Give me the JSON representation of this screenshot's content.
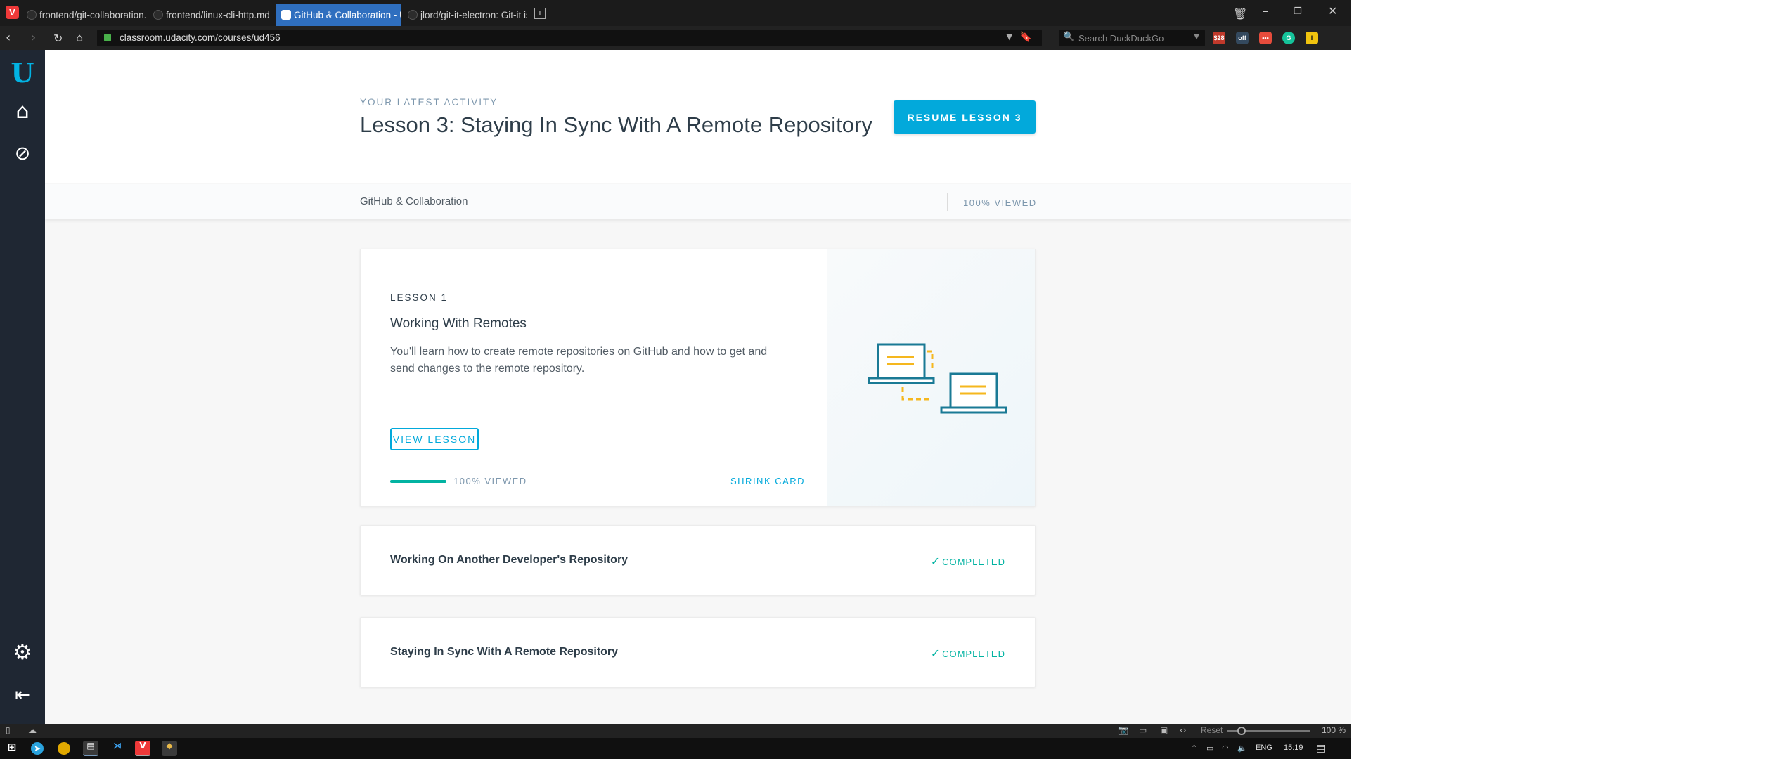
{
  "browser": {
    "tabs": [
      {
        "label": "frontend/git-collaboration.r"
      },
      {
        "label": "frontend/linux-cli-http.md ·"
      },
      {
        "label": "GitHub & Collaboration - U"
      },
      {
        "label": "jlord/git-it-electron: Git-it is"
      }
    ],
    "url": "classroom.udacity.com/courses/ud456",
    "search_placeholder": "Search DuckDuckGo",
    "extension_badge": "$28",
    "extension_badge2": "off"
  },
  "udacity": {
    "activity_label": "YOUR LATEST ACTIVITY",
    "activity_title": "Lesson 3: Staying In Sync With A Remote Repository",
    "resume_label": "RESUME LESSON 3",
    "course_name": "GitHub & Collaboration",
    "course_viewed": "100% VIEWED",
    "lesson_card": {
      "number": "LESSON 1",
      "title": "Working With Remotes",
      "description": "You'll learn how to create remote repositories on GitHub and how to get and send changes to the remote repository.",
      "view_label": "VIEW LESSON",
      "progress_fraction": 1.0,
      "progress_label": "100% VIEWED",
      "shrink_label": "SHRINK CARD"
    },
    "lessons": [
      {
        "title": "Working On Another Developer's Repository",
        "status": "COMPLETED"
      },
      {
        "title": "Staying In Sync With A Remote Repository",
        "status": "COMPLETED"
      }
    ],
    "colors": {
      "accent": "#02a9db",
      "success": "#02b3a2",
      "sidebar": "#1f2733"
    }
  },
  "statusbar": {
    "reset": "Reset",
    "zoom": "100 %"
  },
  "taskbar": {
    "lang": "ENG",
    "time": "15:19"
  }
}
